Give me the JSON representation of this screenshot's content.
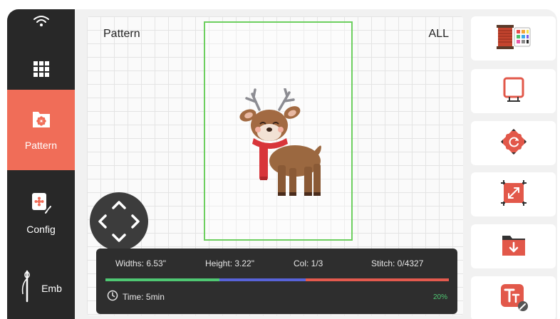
{
  "sidebar": {
    "status_icon": "wifi-icon",
    "menu_icon": "grid-menu-icon",
    "items": [
      {
        "label": "Pattern",
        "icon": "pattern-flower-icon",
        "active": true
      },
      {
        "label": "Config",
        "icon": "config-needle-icon",
        "active": false
      },
      {
        "label": "Emb",
        "icon": "embroidery-needle-icon",
        "active": false
      }
    ]
  },
  "canvas": {
    "title": "Pattern",
    "filter": "ALL",
    "design_icon": "reindeer-design"
  },
  "info": {
    "width": "Widths: 6.53\"",
    "height": "Height: 3.22\"",
    "col": "Col: 1/3",
    "stitch": "Stitch: 0/4327",
    "time": "Time: 5min",
    "percent": "20%",
    "progress_colors": [
      "#4fc873",
      "#5863d9",
      "#e45a4e"
    ]
  },
  "tools": [
    {
      "name": "thread-color-tool",
      "icon": "thread-spool-icon"
    },
    {
      "name": "hoop-tool",
      "icon": "hoop-frame-icon"
    },
    {
      "name": "rotate-tool",
      "icon": "rotate-icon"
    },
    {
      "name": "resize-tool",
      "icon": "resize-icon"
    },
    {
      "name": "import-tool",
      "icon": "folder-download-icon"
    },
    {
      "name": "text-tool",
      "icon": "text-edit-icon"
    }
  ],
  "colors": {
    "accent": "#f06d58",
    "sidebar": "#282828",
    "hoop": "#6dcf5f"
  }
}
